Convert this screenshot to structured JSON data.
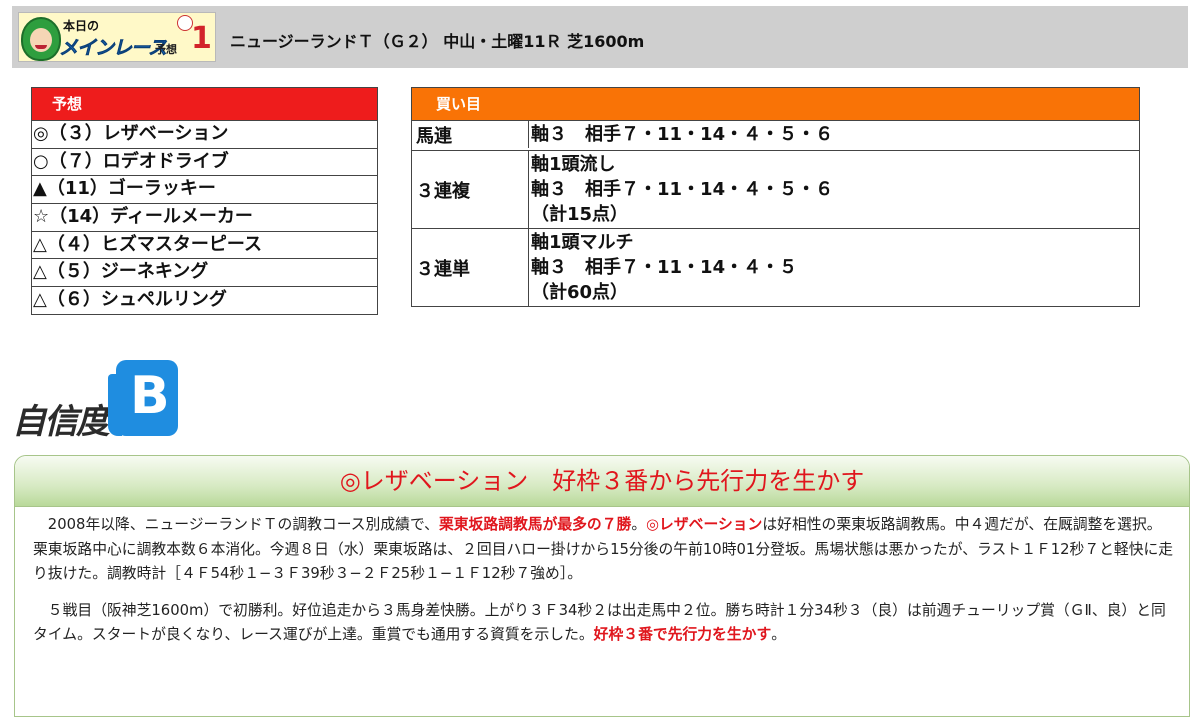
{
  "header": {
    "logo": {
      "line1": "本日の",
      "line2": "メインレース",
      "line3": "予想",
      "number": "1"
    },
    "race_title": "ニュージーランドＴ（Ｇ２） 中山・土曜11Ｒ 芝1600m"
  },
  "prediction": {
    "heading": "予想",
    "rows": [
      "◎（３）レザベーション",
      "○（７）ロデオドライブ",
      "▲（11）ゴーラッキー",
      "☆（14）ディールメーカー",
      "△（４）ヒズマスターピース",
      "△（５）ジーネキング",
      "△（６）シュペルリング"
    ]
  },
  "buy": {
    "heading": "買い目",
    "rows": [
      {
        "type": "馬連",
        "lines": [
          "軸３　相手７・11・14・４・５・６"
        ]
      },
      {
        "type": "３連複",
        "lines": [
          "軸1頭流し",
          "軸３　相手７・11・14・４・５・６",
          "（計15点）"
        ]
      },
      {
        "type": "３連単",
        "lines": [
          "軸1頭マルチ",
          "軸３　相手７・11・14・４・５",
          "（計60点）"
        ]
      }
    ]
  },
  "confidence": {
    "label": "自信度",
    "grade": "B"
  },
  "commentary": {
    "headline": "◎レザベーション　好枠３番から先行力を生かす",
    "p1": {
      "a": "2008年以降、ニュージーランドＴの調教コース別成績で、",
      "b": "栗東坂路調教馬が最多の７勝",
      "c": "。",
      "d": "◎レザベーション",
      "e": "は好相性の栗東坂路調教馬。中４週だが、在厩調整を選択。栗東坂路中心に調教本数６本消化。今週８日（水）栗東坂路は、２回目ハロー掛けから15分後の午前10時01分登坂。馬場状態は悪かったが、ラスト１Ｆ12秒７と軽快に走り抜けた。調教時計［４Ｆ54秒１−３Ｆ39秒３−２Ｆ25秒１−１Ｆ12秒７強め］。"
    },
    "p2": {
      "a": "５戦目（阪神芝1600m）で初勝利。好位追走から３馬身差快勝。上がり３Ｆ34秒２は出走馬中２位。勝ち時計１分34秒３（良）は前週チューリップ賞（ＧⅡ、良）と同タイム。スタートが良くなり、レース運びが上達。重賞でも通用する資質を示した。",
      "b": "好枠３番で先行力を生かす",
      "c": "。"
    }
  },
  "colors": {
    "prediction_header": "#ee1c1c",
    "buy_header": "#f97306",
    "highlight_text": "#e0161d",
    "confidence_badge": "#1f8de0",
    "card_header_green": "#d7eac3"
  }
}
